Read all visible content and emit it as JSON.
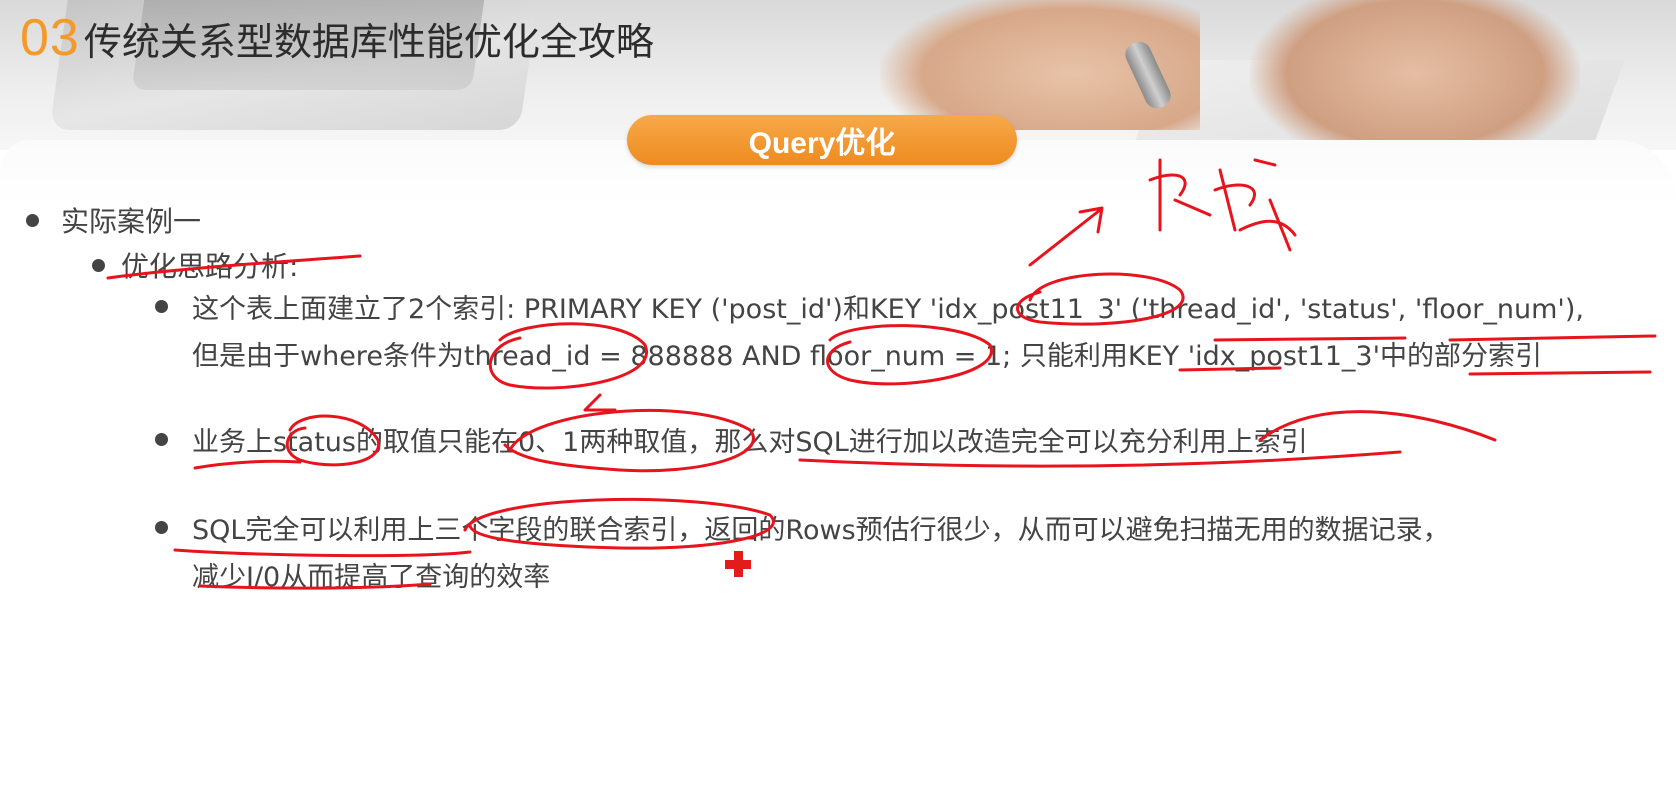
{
  "header": {
    "section_number": "03",
    "title": "传统关系型数据库性能优化全攻略"
  },
  "pill_label": "Query优化",
  "level1": "实际案例一",
  "level2": "优化思路分析:",
  "items": [
    {
      "lines": [
        "这个表上面建立了2个索引: PRIMARY KEY ('post_id')和KEY 'idx_post11_3' ('thread_id', 'status', 'floor_num'),",
        "但是由于where条件为thread_id = 888888 AND floor_num = 1; 只能利用KEY 'idx_post11_3'中的部分索引"
      ]
    },
    {
      "lines": [
        "业务上status的取值只能在0、1两种取值，那么对SQL进行加以改造完全可以充分利用上索引"
      ]
    },
    {
      "lines": [
        "SQL完全可以利用上三个字段的联合索引，返回的Rows预估行很少，从而可以避免扫描无用的数据记录，",
        "减少I/0从而提高了查询的效率"
      ]
    }
  ],
  "colors": {
    "accent": "#f39a2b",
    "pill": "#ee8b1f",
    "ink": "#e8141d",
    "text": "#444444"
  },
  "icons": {
    "bullet": "filled-circle",
    "cursor": "red-cross-cursor"
  }
}
